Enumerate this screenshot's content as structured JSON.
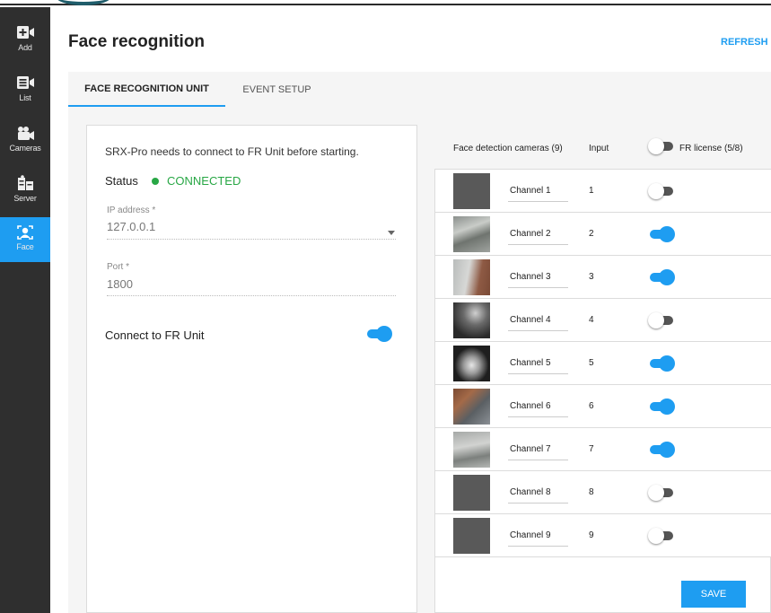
{
  "sidebar": {
    "items": [
      {
        "label": "Add",
        "icon": "add-camera-icon",
        "active": false
      },
      {
        "label": "List",
        "icon": "list-icon",
        "active": false
      },
      {
        "label": "Cameras",
        "icon": "cameras-icon",
        "active": false
      },
      {
        "label": "Server",
        "icon": "server-icon",
        "active": false
      },
      {
        "label": "Face",
        "icon": "face-icon",
        "active": true
      }
    ]
  },
  "header": {
    "title": "Face recognition",
    "refresh_label": "REFRESH"
  },
  "tabs": [
    {
      "label": "FACE RECOGNITION UNIT",
      "active": true
    },
    {
      "label": "EVENT SETUP",
      "active": false
    }
  ],
  "unit": {
    "note": "SRX-Pro needs to connect to FR Unit before starting.",
    "status_label": "Status",
    "status_value": "CONNECTED",
    "ip_label": "IP address *",
    "ip_value": "127.0.0.1",
    "port_label": "Port *",
    "port_value": "1800",
    "connect_label": "Connect to FR Unit",
    "connect_on": true
  },
  "cameras": {
    "header_cameras": "Face detection cameras (9)",
    "header_input": "Input",
    "header_license": "FR license (5/8)",
    "license_toggle_on": false,
    "rows": [
      {
        "name": "Channel 1",
        "input": "1",
        "enabled": false
      },
      {
        "name": "Channel 2",
        "input": "2",
        "enabled": true
      },
      {
        "name": "Channel 3",
        "input": "3",
        "enabled": true
      },
      {
        "name": "Channel 4",
        "input": "4",
        "enabled": false
      },
      {
        "name": "Channel 5",
        "input": "5",
        "enabled": true
      },
      {
        "name": "Channel 6",
        "input": "6",
        "enabled": true
      },
      {
        "name": "Channel 7",
        "input": "7",
        "enabled": true
      },
      {
        "name": "Channel 8",
        "input": "8",
        "enabled": false
      },
      {
        "name": "Channel 9",
        "input": "9",
        "enabled": false
      }
    ]
  },
  "save_label": "SAVE",
  "colors": {
    "accent": "#1e9df1",
    "connected": "#28a745",
    "sidebar": "#2f2f2f"
  }
}
